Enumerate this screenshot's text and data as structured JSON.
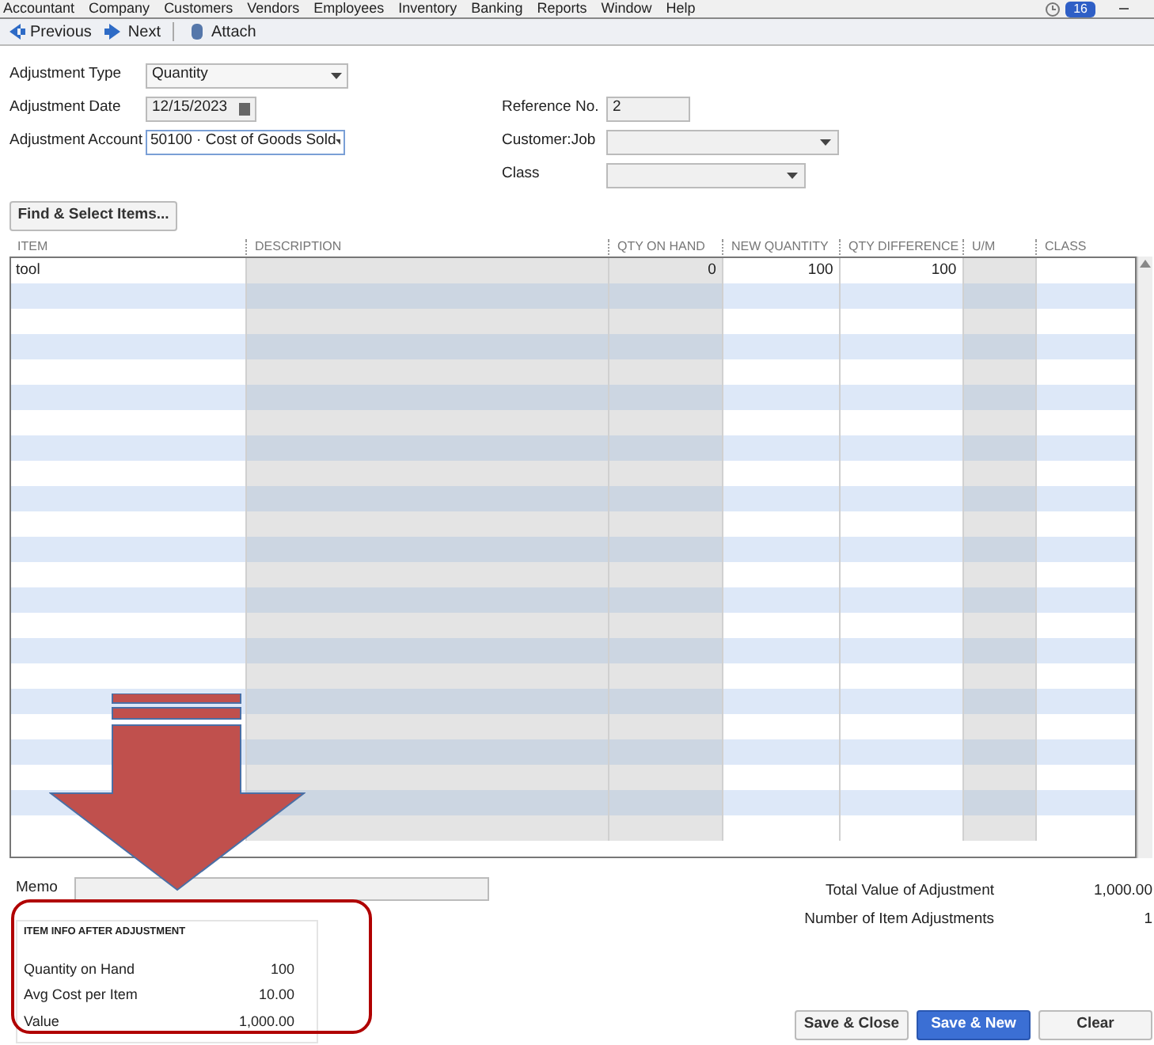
{
  "menu": [
    "Accountant",
    "Company",
    "Customers",
    "Vendors",
    "Employees",
    "Inventory",
    "Banking",
    "Reports",
    "Window",
    "Help"
  ],
  "reminder_badge": "16",
  "toolbar": [
    {
      "label": "Previous",
      "kind": "prev"
    },
    {
      "label": "Next",
      "kind": "next"
    },
    {
      "label": "Attach",
      "kind": "attach"
    }
  ],
  "form": {
    "adjustment_type": {
      "label": "Adjustment Type",
      "value": "Quantity"
    },
    "adjustment_date": {
      "label": "Adjustment Date",
      "value": "12/15/2023"
    },
    "adjustment_account": {
      "label": "Adjustment Account",
      "value": "50100 · Cost of Goods Sold"
    },
    "reference_no": {
      "label": "Reference No.",
      "value": "2"
    },
    "customer_job": {
      "label": "Customer:Job"
    },
    "class": {
      "label": "Class"
    }
  },
  "find_button": "Find & Select Items...",
  "table": {
    "columns": [
      "ITEM",
      "DESCRIPTION",
      "QTY ON HAND",
      "NEW QUANTITY",
      "QTY DIFFERENCE",
      "U/M",
      "CLASS"
    ],
    "rows": [
      [
        "tool",
        "",
        "0",
        "100",
        "100",
        "",
        ""
      ]
    ]
  },
  "memo": {
    "label": "Memo"
  },
  "totals": [
    {
      "label": "Total Value of Adjustment",
      "value": "1,000.00"
    },
    {
      "label": "Number of Item Adjustments",
      "value": "1"
    }
  ],
  "item_info": {
    "title": "ITEM INFO AFTER ADJUSTMENT",
    "rows": [
      {
        "label": "Quantity on Hand",
        "value": "100"
      },
      {
        "label": "Avg Cost per Item",
        "value": "10.00"
      },
      {
        "label": "Value",
        "value": "1,000.00"
      }
    ]
  },
  "buttons": [
    {
      "label": "Save & Close",
      "primary": false
    },
    {
      "label": "Save & New",
      "primary": true
    },
    {
      "label": "Clear",
      "primary": false
    }
  ]
}
